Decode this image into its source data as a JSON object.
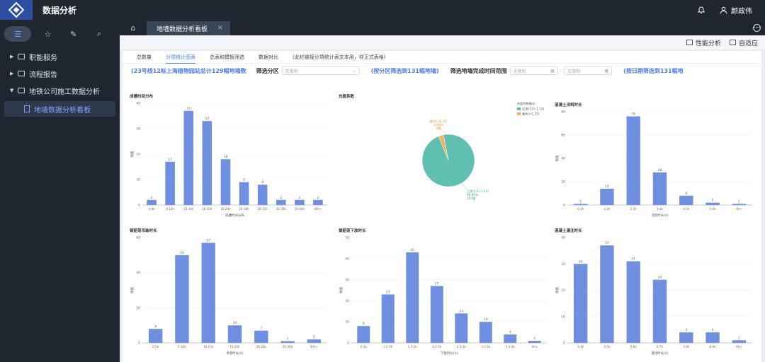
{
  "app": {
    "title": "数据分析",
    "user": "颜政伟"
  },
  "sidebar": {
    "items": [
      {
        "label": "职能服务",
        "expanded": false
      },
      {
        "label": "流程报告",
        "expanded": false
      },
      {
        "label": "地铁公司施工数据分析",
        "expanded": true
      }
    ],
    "active_sub": "地墙数据分析看板"
  },
  "tabbar": {
    "active_tab": "地墙数据分析看板"
  },
  "toolbar": {
    "perf": "性能分析",
    "adapt": "自适应"
  },
  "panel": {
    "tabs": [
      "总数量",
      "分项统计图表",
      "总表和模板筛选",
      "数据对比",
      "(此栏链接分项统计表文本用，非正式表格)"
    ],
    "active_tab_index": 1,
    "summary": "(23号线12标上海植物园站总计129幅地墙数",
    "filter_area_label": "筛选分区",
    "filter_area_placeholder": "无限制",
    "filter_area_result": "(按分区筛选到131幅地墙)",
    "filter_date_label": "筛选地墙完成时间范围",
    "date_from_placeholder": "无限制",
    "date_to_placeholder": "无限制",
    "filter_date_result": "(按日期筛选到131幅地"
  },
  "chart_data": [
    {
      "type": "bar",
      "title": "成槽时间分布",
      "xlabel": "成槽时间分布",
      "ylabel": "地墙",
      "categories": [
        "4-8h",
        "8-12h",
        "12-16h",
        "16-20h",
        "20-24h",
        "24-28h",
        "28-32h",
        "32-36h",
        "36-40h",
        "40h+"
      ],
      "values": [
        2,
        17,
        37,
        33,
        18,
        9,
        8,
        2,
        2,
        2
      ],
      "ylim": [
        0,
        40
      ],
      "yticks": [
        0,
        10,
        20,
        30,
        40
      ]
    },
    {
      "type": "pie",
      "title": "充盈系数",
      "legend_title": "充盈系数情况",
      "legend": [
        "正常(1.0~1.15)",
        "偏大(>1.15)"
      ],
      "slices": [
        {
          "label": "正常(1.0~1.15)",
          "value": 127,
          "percent": "96.95%",
          "color": "#5fbfb0"
        },
        {
          "label": "偏大(>1.15)",
          "value": 4,
          "percent": "3.05%",
          "color": "#f0b45a"
        }
      ],
      "label_small": "偏大(>1.15)",
      "label_small_percent": "3.05%",
      "label_small_count": "4幅",
      "label_big": "正常(1.0~1.15)",
      "label_big_percent": "96.95%",
      "label_big_count": "127幅"
    },
    {
      "type": "bar",
      "title": "混凝土浇筑时长",
      "xlabel": "浇筑时长(h)",
      "ylabel": "地墙",
      "categories": [
        "0-1h",
        "1-2h",
        "2-3h",
        "3-4h",
        "4-5h",
        "5-6h",
        "6h+"
      ],
      "values": [
        1,
        14,
        76,
        28,
        8,
        2,
        1
      ],
      "ylim": [
        0,
        80
      ],
      "yticks": [
        0,
        20,
        40,
        60,
        80
      ]
    },
    {
      "type": "bar",
      "title": "钢筋笼吊装时长",
      "xlabel": "吊装时长(h)",
      "ylabel": "地墙",
      "categories": [
        "0-5h",
        "5-10h",
        "10-15h",
        "15-20h",
        "20-25h",
        "25-30h",
        "30h+"
      ],
      "values": [
        8,
        50,
        57,
        10,
        7,
        1,
        2
      ],
      "ylim": [
        0,
        60
      ],
      "yticks": [
        0,
        20,
        40,
        60
      ]
    },
    {
      "type": "bar",
      "title": "钢筋笼下放时长",
      "xlabel": "下放时长(h)",
      "ylabel": "地墙",
      "categories": [
        "0-1h",
        "1-1.5h",
        "1.5-2h",
        "2-2.5h",
        "2.5-3h",
        "3-3.5h",
        "3.5-4h",
        "4h+"
      ],
      "values": [
        8,
        23,
        43,
        27,
        14,
        10,
        4,
        1
      ],
      "ylim": [
        0,
        50
      ],
      "yticks": [
        0,
        10,
        20,
        30,
        40,
        50
      ]
    },
    {
      "type": "bar",
      "title": "混凝土灌注时长",
      "xlabel": "灌注时长(h)",
      "ylabel": "地墙",
      "categories": [
        "3-4h",
        "4-5h",
        "5-6h",
        "6-7h",
        "7-8h",
        "8-9h",
        "9h+"
      ],
      "values": [
        30,
        37,
        31,
        24,
        4,
        4,
        1
      ],
      "ylim": [
        0,
        40
      ],
      "yticks": [
        0,
        10,
        20,
        30,
        40
      ]
    }
  ]
}
